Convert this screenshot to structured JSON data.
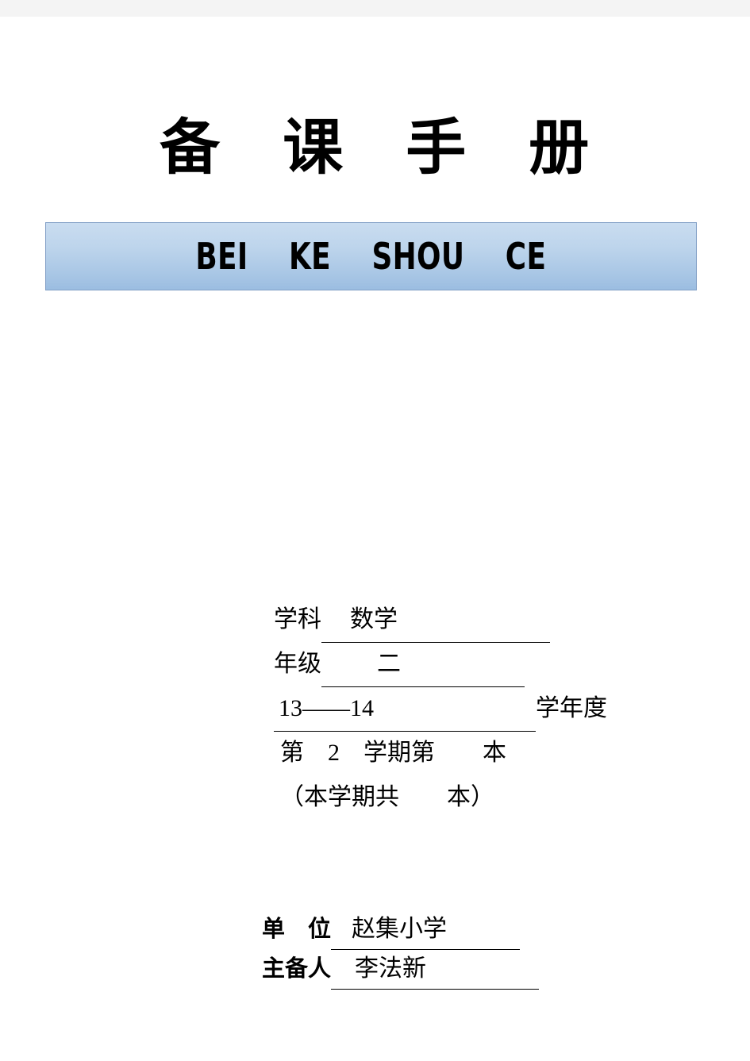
{
  "document": {
    "cover_title": "备　课　手　册",
    "cover_title_pinyin": "BEI    KE    SHOU    CE",
    "banner_color_top": "#c9dcf0",
    "banner_color_bottom": "#9bbde1",
    "banner_border_color": "#829fc6"
  },
  "fields": {
    "subject": {
      "label": "学科",
      "value": "数学"
    },
    "grade": {
      "label": "年级",
      "value": "二"
    },
    "academic_year": {
      "value": "13——14",
      "suffix": "学年度"
    },
    "term": {
      "text": "第　2　学期第　　本"
    },
    "term_total": {
      "text": "（本学期共　　本）"
    },
    "unit": {
      "label": "单　位",
      "value": "赵集小学"
    },
    "author": {
      "label": "主备人",
      "value": "李法新"
    }
  }
}
